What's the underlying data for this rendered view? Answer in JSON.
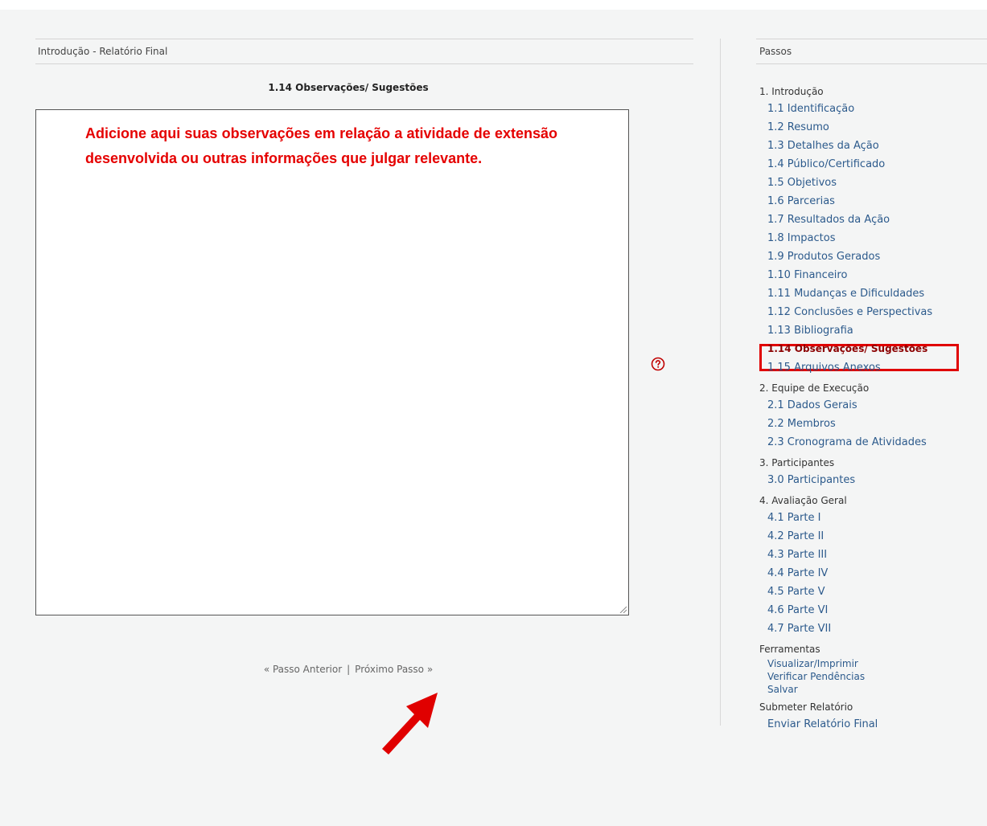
{
  "header": {
    "breadcrumb": "Introdução - Relatório Final"
  },
  "main": {
    "section_title": "1.14 Observações/ Sugestões",
    "textarea_value": "Adicione aqui suas observações em relação a atividade de extensão desenvolvida ou outras informações que julgar relevante.",
    "help_icon": "question-circle-icon",
    "nav": {
      "prev_label": "« Passo Anterior",
      "separator": "|",
      "next_label": "Próximo Passo »"
    },
    "annotation_arrow_color": "#e00000"
  },
  "sidebar": {
    "title": "Passos",
    "groups": [
      {
        "label": "1. Introdução",
        "items": [
          "1.1 Identificação",
          "1.2 Resumo",
          "1.3 Detalhes da Ação",
          "1.4 Público/Certificado",
          "1.5 Objetivos",
          "1.6 Parcerias",
          "1.7 Resultados da Ação",
          "1.8 Impactos",
          "1.9 Produtos Gerados",
          "1.10 Financeiro",
          "1.11 Mudanças e Dificuldades",
          "1.12 Conclusões e Perspectivas",
          "1.13 Bibliografia",
          "1.14 Observações/ Sugestões",
          "1.15 Arquivos Anexos"
        ]
      },
      {
        "label": "2. Equipe de Execução",
        "items": [
          "2.1 Dados Gerais",
          "2.2 Membros",
          "2.3 Cronograma de Atividades"
        ]
      },
      {
        "label": "3. Participantes",
        "items": [
          "3.0 Participantes"
        ]
      },
      {
        "label": "4. Avaliação Geral",
        "items": [
          "4.1 Parte I",
          "4.2 Parte II",
          "4.3 Parte III",
          "4.4 Parte IV",
          "4.5 Parte V",
          "4.6 Parte VI",
          "4.7 Parte VII"
        ]
      }
    ],
    "tools": {
      "label": "Ferramentas",
      "items": [
        "Visualizar/Imprimir",
        "Verificar Pendências",
        "Salvar"
      ]
    },
    "submit": {
      "label": "Submeter Relatório",
      "items": [
        "Enviar Relatório Final"
      ]
    },
    "current_step": "1.14 Observações/ Sugestões",
    "highlight_color": "#e00000"
  }
}
